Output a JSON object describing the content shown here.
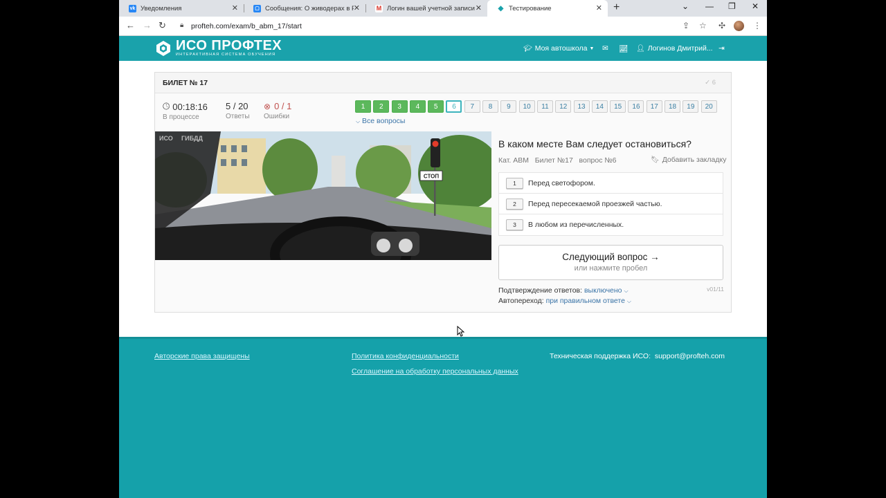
{
  "browser": {
    "tabs": [
      {
        "label": "Уведомления",
        "favicon": "vk-icon",
        "active": false
      },
      {
        "label": "Сообщения: О живодерах в Ро",
        "favicon": "vk-messages-icon",
        "active": false
      },
      {
        "label": "Логин вашей учетной записи б",
        "favicon": "gmail-icon",
        "active": false
      },
      {
        "label": "Тестирование",
        "favicon": "site-icon",
        "active": true
      }
    ],
    "url": "profteh.com/exam/b_abm_17/start"
  },
  "header": {
    "logo_title": "ИСО ПРОФТЕХ",
    "logo_subtitle": "ИНТЕРАКТИВНАЯ СИСТЕМА ОБУЧЕНИЯ",
    "school_menu": "Моя автошкола",
    "user_name": "Логинов Дмитрий...",
    "brand_color": "#1aa2ab"
  },
  "exam": {
    "ticket_title": "БИЛЕТ № 17",
    "ticket_check": "6",
    "timer": "00:18:16",
    "timer_label": "В процессе",
    "answers_value": "5 / 20",
    "answers_label": "Ответы",
    "errors_value": "0 / 1",
    "errors_label": "Ошибки",
    "questions": [
      {
        "n": "1",
        "state": "done"
      },
      {
        "n": "2",
        "state": "done"
      },
      {
        "n": "3",
        "state": "done"
      },
      {
        "n": "4",
        "state": "done"
      },
      {
        "n": "5",
        "state": "done"
      },
      {
        "n": "6",
        "state": "current"
      },
      {
        "n": "7",
        "state": "todo"
      },
      {
        "n": "8",
        "state": "todo"
      },
      {
        "n": "9",
        "state": "todo"
      },
      {
        "n": "10",
        "state": "todo"
      },
      {
        "n": "11",
        "state": "todo"
      },
      {
        "n": "12",
        "state": "todo"
      },
      {
        "n": "13",
        "state": "todo"
      },
      {
        "n": "14",
        "state": "todo"
      },
      {
        "n": "15",
        "state": "todo"
      },
      {
        "n": "16",
        "state": "todo"
      },
      {
        "n": "17",
        "state": "todo"
      },
      {
        "n": "18",
        "state": "todo"
      },
      {
        "n": "19",
        "state": "todo"
      },
      {
        "n": "20",
        "state": "todo"
      }
    ],
    "all_questions": "Все вопросы",
    "photo_watermark_1": "ИСО",
    "photo_watermark_2": "ГИБДД",
    "photo_sign": "СТОП",
    "question_text": "В каком месте Вам следует остановиться?",
    "meta_category": "Кат. ABM",
    "meta_ticket": "Билет №17",
    "meta_question": "вопрос №6",
    "bookmark_label": "Добавить закладку",
    "answers": [
      {
        "num": "1",
        "text": "Перед светофором."
      },
      {
        "num": "2",
        "text": "Перед пересекаемой проезжей частью."
      },
      {
        "num": "3",
        "text": "В любом из перечисленных."
      }
    ],
    "next_label": "Следующий вопрос →",
    "next_sub": "или нажмите пробел",
    "confirm_label": "Подтверждение ответов:",
    "confirm_value": "выключено",
    "autogo_label": "Автопереход:",
    "autogo_value": "при правильном ответе",
    "version": "v01/11"
  },
  "footer": {
    "copyright": "Авторские права защищены",
    "privacy": "Политика конфиденциальности",
    "consent": "Соглашение на обработку персональных данных",
    "support_label": "Техническая поддержка ИСО:",
    "support_email": "support@profteh.com"
  }
}
